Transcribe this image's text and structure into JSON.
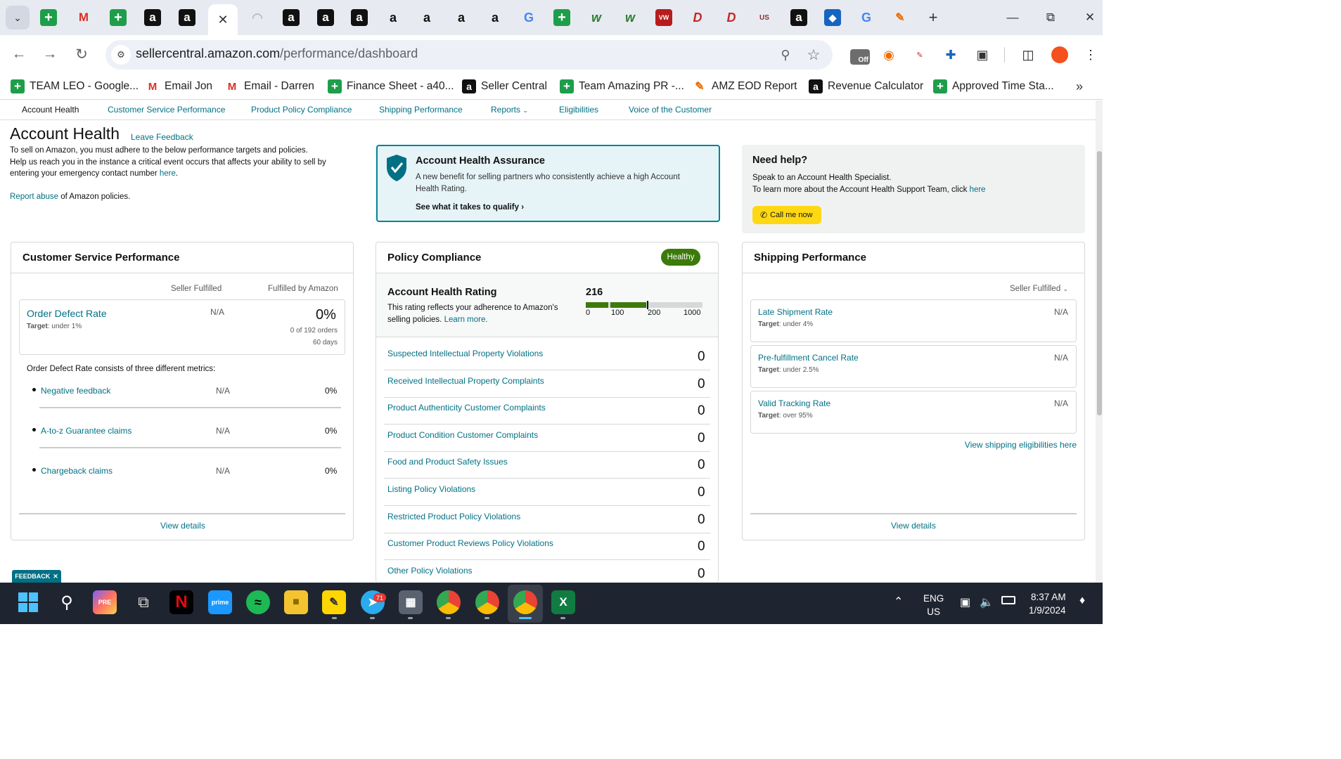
{
  "browser": {
    "url_host": "sellercentral.amazon.com",
    "url_path": "/performance/dashboard",
    "bookmarks": [
      {
        "label": "TEAM LEO - Google...",
        "icon": "sheets-icon"
      },
      {
        "label": "Email Jon",
        "icon": "gmail-icon"
      },
      {
        "label": "Email - Darren",
        "icon": "gmail-icon"
      },
      {
        "label": "Finance Sheet - a40...",
        "icon": "sheets-icon"
      },
      {
        "label": "Seller Central",
        "icon": "amazon-icon"
      },
      {
        "label": "Team Amazing PR -...",
        "icon": "sheets-icon"
      },
      {
        "label": "AMZ EOD Report",
        "icon": "report-icon"
      },
      {
        "label": "Revenue Calculator",
        "icon": "amazon-icon"
      },
      {
        "label": "Approved Time Sta...",
        "icon": "sheets-icon"
      }
    ],
    "extension_badge": "Off"
  },
  "subnav": [
    "Account Health",
    "Customer Service Performance",
    "Product Policy Compliance",
    "Shipping Performance",
    "Reports",
    "Eligibilities",
    "Voice of the Customer"
  ],
  "header": {
    "title": "Account Health",
    "feedback": "Leave Feedback",
    "intro1": "To sell on Amazon, you must adhere to the below performance targets and policies.",
    "intro2": "Help us reach you in the instance a critical event occurs that affects your ability to sell by",
    "intro3": "entering your emergency contact number",
    "intro_link": "here",
    "abuse_link": "Report abuse",
    "abuse_rest": "of Amazon policies."
  },
  "assurance": {
    "title": "Account Health Assurance",
    "body1": "A new benefit for selling partners who consistently achieve a high Account",
    "body2": "Health Rating.",
    "cta": "See what it takes to qualify"
  },
  "help": {
    "title": "Need help?",
    "line1": "Speak to an Account Health Specialist.",
    "line2": "To learn more about the Account Health Support Team, click",
    "link": "here",
    "button": "Call me now"
  },
  "csp": {
    "title": "Customer Service Performance",
    "col_seller": "Seller Fulfilled",
    "col_fba": "Fulfilled by Amazon",
    "odr_label": "Order Defect Rate",
    "odr_target_label": "Target",
    "odr_target": ": under 1%",
    "odr_seller": "N/A",
    "odr_fba": "0%",
    "odr_orders": "0 of 192 orders",
    "odr_days": "60 days",
    "consists": "Order Defect Rate consists of three different metrics:",
    "sub": [
      {
        "label": "Negative feedback",
        "seller": "N/A",
        "fba": "0%"
      },
      {
        "label": "A-to-z Guarantee claims",
        "seller": "N/A",
        "fba": "0%"
      },
      {
        "label": "Chargeback claims",
        "seller": "N/A",
        "fba": "0%"
      }
    ],
    "view": "View details"
  },
  "policy": {
    "title": "Policy Compliance",
    "badge": "Healthy",
    "ahr_title": "Account Health Rating",
    "ahr_desc1": "This rating reflects your adherence to Amazon's",
    "ahr_desc2": "selling policies.",
    "ahr_link": "Learn more.",
    "score": "216",
    "scale": [
      "0",
      "100",
      "200",
      "1000"
    ],
    "items": [
      {
        "label": "Suspected Intellectual Property Violations",
        "value": "0"
      },
      {
        "label": "Received Intellectual Property Complaints",
        "value": "0"
      },
      {
        "label": "Product Authenticity Customer Complaints",
        "value": "0"
      },
      {
        "label": "Product Condition Customer Complaints",
        "value": "0"
      },
      {
        "label": "Food and Product Safety Issues",
        "value": "0"
      },
      {
        "label": "Listing Policy Violations",
        "value": "0"
      },
      {
        "label": "Restricted Product Policy Violations",
        "value": "0"
      },
      {
        "label": "Customer Product Reviews Policy Violations",
        "value": "0"
      },
      {
        "label": "Other Policy Violations",
        "value": "0"
      }
    ]
  },
  "shipping": {
    "title": "Shipping Performance",
    "filter": "Seller Fulfilled",
    "target_label": "Target",
    "items": [
      {
        "label": "Late Shipment Rate",
        "target": ": under 4%",
        "value": "N/A"
      },
      {
        "label": "Pre-fulfillment Cancel Rate",
        "target": ": under 2.5%",
        "value": "N/A"
      },
      {
        "label": "Valid Tracking Rate",
        "target": ": over 95%",
        "value": "N/A"
      }
    ],
    "elig": "View shipping eligibilities here",
    "view": "View details"
  },
  "feedback_tab": "FEEDBACK",
  "taskbar": {
    "telegram_badge": "71",
    "lang1": "ENG",
    "lang2": "US",
    "time": "8:37 AM",
    "date": "1/9/2024"
  }
}
